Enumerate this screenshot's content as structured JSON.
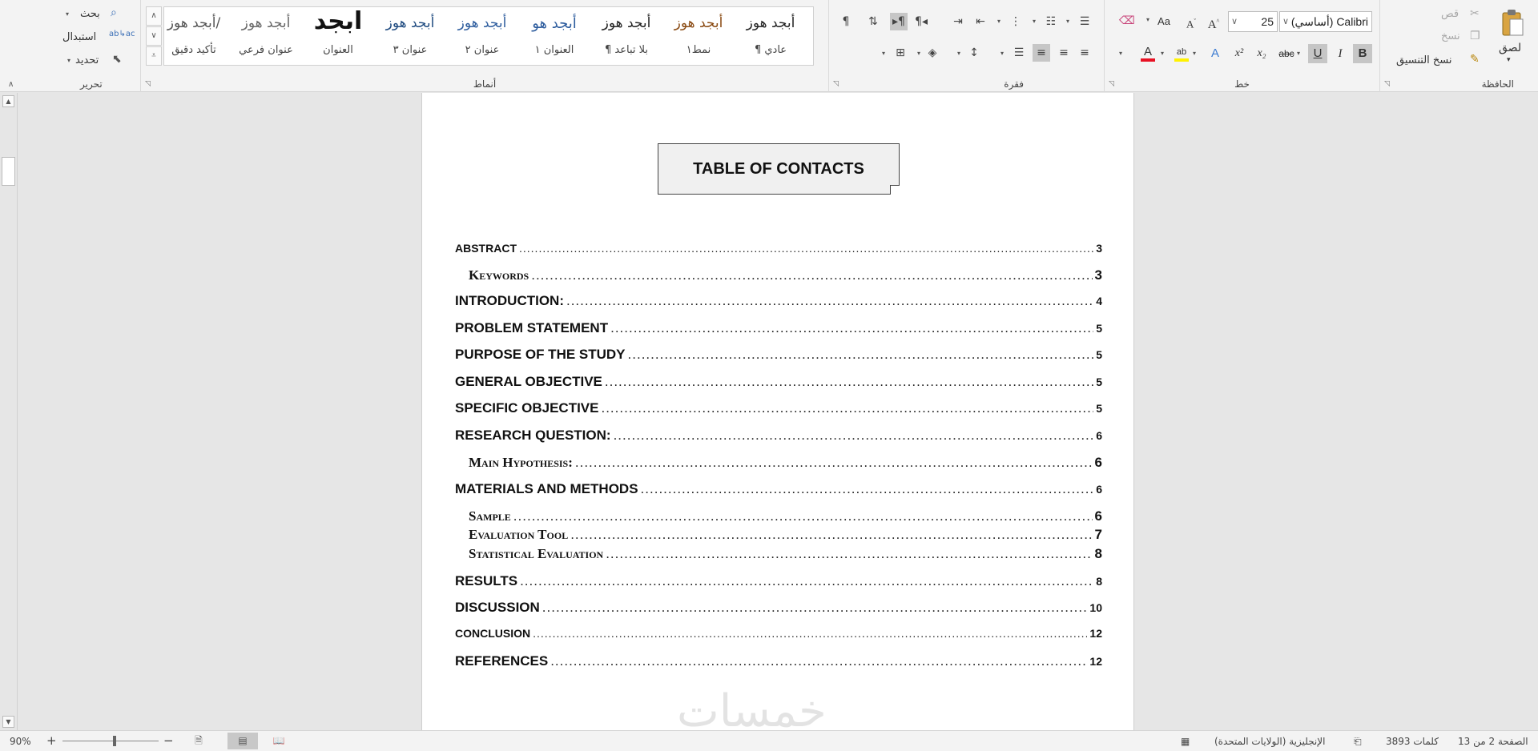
{
  "ribbon": {
    "clipboard": {
      "label": "الحافظة",
      "paste": "لصق",
      "cut": "قص",
      "copy": "نسخ",
      "format_painter": "نسخ التنسيق"
    },
    "font": {
      "label": "خط",
      "font_name": "Calibri (أساسي)",
      "font_size": "25",
      "bold": "B",
      "italic": "I",
      "underline": "U",
      "strike": "abc",
      "subscript": "x₂",
      "superscript": "x²",
      "change_case": "Aa",
      "grow": "A",
      "shrink": "A",
      "text_effects": "A",
      "highlight": "ab",
      "font_color": "A",
      "font_color_value": "#e81123",
      "highlight_value": "#fff200"
    },
    "paragraph": {
      "label": "فقرة",
      "pilcrow": "¶"
    },
    "styles": {
      "label": "أنماط",
      "items": [
        {
          "sample": "أبجد هوز",
          "name": "¶ عادي",
          "color": "#222222"
        },
        {
          "sample": "أبجد هوز",
          "name": "نمط١",
          "color": "#8a4a12"
        },
        {
          "sample": "أبجد هوز",
          "name": "¶ بلا تباعد",
          "color": "#222222"
        },
        {
          "sample": "أبجد هو",
          "name": "العنوان ١",
          "color": "#2e5d9e"
        },
        {
          "sample": "أبجد هوز",
          "name": "عنوان ٢",
          "color": "#2e5d9e"
        },
        {
          "sample": "أبجد هوز",
          "name": "عنوان ٣",
          "color": "#1f4b80"
        },
        {
          "sample": "ابجد",
          "name": "العنوان",
          "color": "#111111"
        },
        {
          "sample": "أبجد هوز",
          "name": "عنوان فرعي",
          "color": "#666666"
        },
        {
          "sample": "أبجد هوز/",
          "name": "تأكيد دقيق",
          "color": "#555555"
        }
      ]
    },
    "editing": {
      "label": "تحرير",
      "find": "بحث",
      "replace": "استبدال",
      "select": "تحديد"
    }
  },
  "document": {
    "title": "TABLE OF CONTACTS",
    "toc": [
      {
        "label": "ABSTRACT",
        "page": "3",
        "level": "lv1s"
      },
      {
        "label": "Keywords",
        "page": "3",
        "level": "lv2"
      },
      {
        "label": "INTRODUCTION:",
        "page": "4",
        "level": "lv1"
      },
      {
        "label": "PROBLEM STATEMENT",
        "page": "5",
        "level": "lv1"
      },
      {
        "label": "PURPOSE OF THE STUDY",
        "page": "5",
        "level": "lv1"
      },
      {
        "label": "GENERAL OBJECTIVE",
        "page": "5",
        "level": "lv1"
      },
      {
        "label": "SPECIFIC OBJECTIVE",
        "page": "5",
        "level": "lv1"
      },
      {
        "label": "RESEARCH QUESTION:",
        "page": "6",
        "level": "lv1"
      },
      {
        "label": "Main Hypothesis:",
        "page": "6",
        "level": "lv2"
      },
      {
        "label": "MATERIALS AND METHODS",
        "page": "6",
        "level": "lv1"
      },
      {
        "label": "Sample",
        "page": "6",
        "level": "lv2"
      },
      {
        "label": "Evaluation Tool",
        "page": "7",
        "level": "lv2"
      },
      {
        "label": "Statistical Evaluation",
        "page": "8",
        "level": "lv2"
      },
      {
        "label": "RESULTS",
        "page": "8",
        "level": "lv1"
      },
      {
        "label": "DISCUSSION",
        "page": "10",
        "level": "lv1"
      },
      {
        "label": "CONCLUSION",
        "page": "12",
        "level": "lv1s"
      },
      {
        "label": "REFERENCES",
        "page": "12",
        "level": "lv1"
      }
    ],
    "watermark": "خمسات"
  },
  "status": {
    "page_info": "الصفحة 2 من 13",
    "word_count": "3893 كلمات",
    "language": "الإنجليزية (الولايات المتحدة)",
    "zoom": "90%"
  }
}
